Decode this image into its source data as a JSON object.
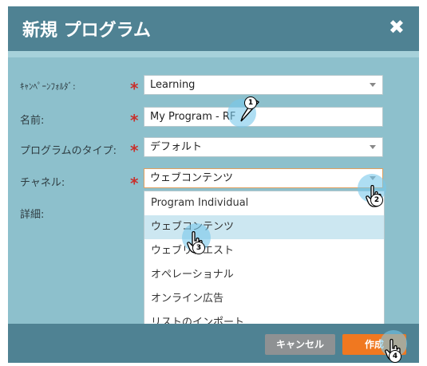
{
  "dialog": {
    "title": "新規 プログラム",
    "close_label": "✖"
  },
  "form": {
    "campaign_folder": {
      "label": "ｷｬﾝﾍﾟｰﾝﾌｫﾙﾀﾞ:",
      "value": "Learning"
    },
    "name": {
      "label": "名前:",
      "value": "My Program - RF"
    },
    "program_type": {
      "label": "プログラムのタイプ:",
      "value": "デフォルト"
    },
    "channel": {
      "label": "チャネル:",
      "value": "ウェブコンテンツ"
    },
    "details": {
      "label": "詳細:"
    }
  },
  "channel_dropdown": {
    "options": [
      "Program Individual",
      "ウェブコンテンツ",
      "ウェブリクエスト",
      "オペレーショナル",
      "オンライン広告",
      "リストのインポート"
    ],
    "selected_index": 1
  },
  "footer": {
    "cancel_label": "キャンセル",
    "create_label": "作成"
  },
  "steps": {
    "one": "1",
    "two": "2",
    "three": "3",
    "four": "4"
  },
  "colors": {
    "header": "#4f8293",
    "body": "#8dc0cc",
    "primary_button": "#f07820",
    "secondary_button": "#8e9193",
    "required": "#c9302c",
    "highlight": "#cce7f1"
  }
}
